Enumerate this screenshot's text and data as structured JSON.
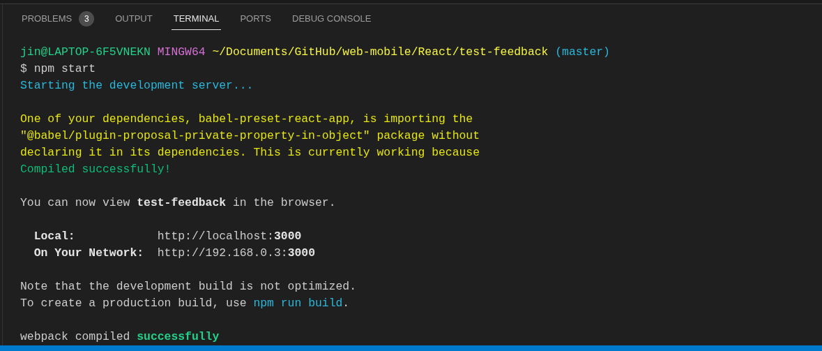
{
  "tabs": [
    {
      "label": "PROBLEMS",
      "badge": "3",
      "selected": false
    },
    {
      "label": "OUTPUT",
      "selected": false
    },
    {
      "label": "TERMINAL",
      "selected": true
    },
    {
      "label": "PORTS",
      "selected": false
    },
    {
      "label": "DEBUG CONSOLE",
      "selected": false
    }
  ],
  "terminal_lines": [
    {
      "segments": [
        {
          "text": "jin@LAPTOP-6F5VNEKN",
          "kind": "user"
        },
        {
          "text": " MINGW64",
          "kind": "shell"
        },
        {
          "text": " ~/Documents/GitHub/web-mobile/React/test-feedback",
          "kind": "path"
        },
        {
          "text": " (master)",
          "kind": "branch"
        }
      ]
    },
    {
      "segments": [
        {
          "text": "$ npm start"
        }
      ]
    },
    {
      "segments": [
        {
          "text": "Starting the development server...",
          "kind": "info"
        }
      ]
    },
    {
      "kind": "blank"
    },
    {
      "segments": [
        {
          "text": "One of your dependencies, babel-preset-react-app, is importing the",
          "kind": "warning"
        }
      ]
    },
    {
      "segments": [
        {
          "text": "\"@babel/plugin-proposal-private-property-in-object\" package without",
          "kind": "warning"
        }
      ]
    },
    {
      "segments": [
        {
          "text": "declaring it in its dependencies. This is currently working because",
          "kind": "warning"
        }
      ]
    },
    {
      "segments": [
        {
          "text": "Compiled successfully!",
          "kind": "success"
        }
      ]
    },
    {
      "kind": "blank"
    },
    {
      "segments": [
        {
          "text": "You can now view "
        },
        {
          "text": "test-feedback",
          "kind": "bold"
        },
        {
          "text": " in the browser."
        }
      ]
    },
    {
      "kind": "blank"
    },
    {
      "segments": [
        {
          "text": "  Local:",
          "kind": "bold"
        },
        {
          "text": "            http://localhost:"
        },
        {
          "text": "3000",
          "kind": "bold"
        }
      ]
    },
    {
      "segments": [
        {
          "text": "  On Your Network:",
          "kind": "bold"
        },
        {
          "text": "  http://192.168.0.3:"
        },
        {
          "text": "3000",
          "kind": "bold"
        }
      ]
    },
    {
      "kind": "blank"
    },
    {
      "segments": [
        {
          "text": "Note that the development build is not optimized."
        }
      ]
    },
    {
      "segments": [
        {
          "text": "To create a production build, use "
        },
        {
          "text": "npm run build",
          "kind": "info"
        },
        {
          "text": "."
        }
      ]
    },
    {
      "kind": "blank"
    },
    {
      "segments": [
        {
          "text": "webpack compiled "
        },
        {
          "text": "successfully",
          "kind": "bold-success"
        }
      ]
    }
  ]
}
